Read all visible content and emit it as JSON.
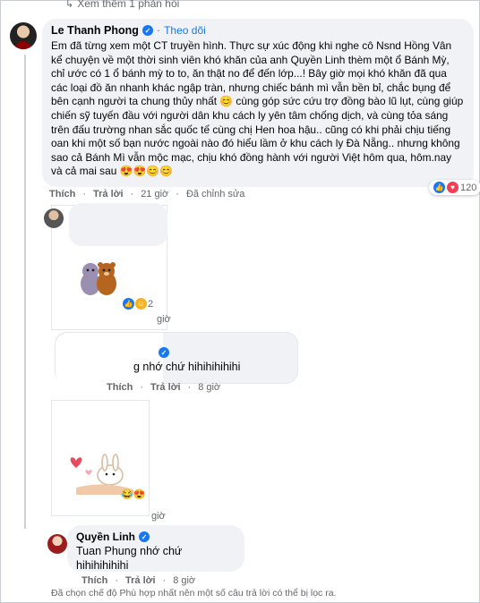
{
  "see_more": "Xem thêm 1 phản hồi",
  "main_comment": {
    "author": "Le Thanh Phong",
    "follow": "Theo dõi",
    "separator": "·",
    "text": "Em đã từng xem một CT truyền hình. Thực sự xúc động khi nghe cô Nsnd Hồng Vân kể chuyện về một thời sinh viên khó khăn của anh Quyền Linh thèm một ổ Bánh Mỳ, chỉ ước có 1 ổ bánh mỳ to to, ăn thật no để đến lớp...! Bây giờ mọi khó khăn đã qua các loại đồ ăn nhanh khác ngập tràn, nhưng chiếc bánh mì vẫn bền bỉ, chắc bụng để bên cạnh người ta chung thủy nhất 😊 cùng góp sức cứu trợ đồng bào lũ lụt, cùng giúp chiến sỹ tuyến đầu với người dân khu cách ly yên tâm chống dịch, và cùng tỏa sáng trên đấu trường nhan sắc quốc tế cùng chị Hen hoa hậu.. cũng có khi phải chịu tiếng oan khi một số bạn nước ngoài nào đó hiểu lầm ở khu cách ly Đà Nẵng.. nhưng không sao cả Bánh Mì vẫn mộc mạc, chịu khó đồng hành với người Việt hôm qua, hôm.nay và cả mai sau 😍😍😊😊",
    "actions": {
      "like": "Thích",
      "reply": "Trả lời",
      "time": "21 giờ",
      "edited": "Đã chỉnh sửa"
    },
    "reaction_count": "120"
  },
  "reply1": {
    "reaction_count": "2",
    "partial_time": "giờ"
  },
  "reply2": {
    "text_fragment": "g nhớ chứ hihihihihihi",
    "actions": {
      "like": "Thích",
      "reply": "Trả lời",
      "time": "8 giờ"
    }
  },
  "reply3": {
    "partial_time": "giờ"
  },
  "reply4": {
    "author": "Quyền Linh",
    "text": "Tuan Phung nhớ chứ hihihihihihi",
    "actions": {
      "like": "Thích",
      "reply": "Trả lời",
      "time": "8 giờ"
    }
  },
  "footer_note": "Đã chọn chế độ Phù hợp nhất nên một số câu trả lời có thể bị lọc ra.",
  "colors": {
    "accent": "#1877f2",
    "bubble": "#f0f2f5",
    "muted": "#65676b"
  }
}
